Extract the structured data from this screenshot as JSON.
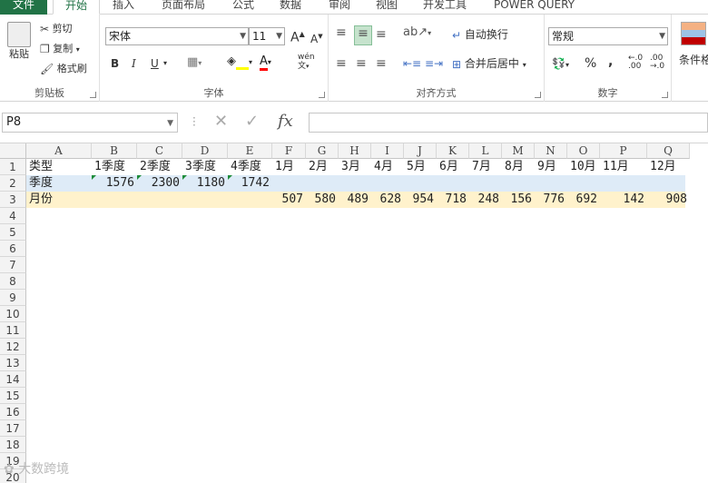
{
  "tabs": [
    "文件",
    "开始",
    "插入",
    "页面布局",
    "公式",
    "数据",
    "审阅",
    "视图",
    "开发工具",
    "POWER QUERY"
  ],
  "clipboard": {
    "paste": "粘贴",
    "cut": "剪切",
    "copy": "复制",
    "format_painter": "格式刷",
    "label": "剪贴板"
  },
  "font": {
    "name": "宋体",
    "size": "11",
    "label": "字体",
    "bold": "B",
    "italic": "I",
    "underline": "U",
    "grow": "A",
    "shrink": "A",
    "phonetic": "wén"
  },
  "alignment": {
    "wrap": "自动换行",
    "merge": "合并后居中",
    "label": "对齐方式"
  },
  "number": {
    "format": "常规",
    "label": "数字",
    "percent": "%",
    "comma": ",",
    "inc": ".00",
    "dec": ".0"
  },
  "styles": {
    "conditional": "条件格式"
  },
  "formula_bar": {
    "name_box": "P8",
    "fx": "fx",
    "content": ""
  },
  "columns": [
    "A",
    "B",
    "C",
    "D",
    "E",
    "F",
    "G",
    "H",
    "I",
    "J",
    "K",
    "L",
    "M",
    "N",
    "O",
    "P",
    "Q"
  ],
  "rows": [
    "1",
    "2",
    "3",
    "4",
    "5",
    "6",
    "7",
    "8",
    "9",
    "10",
    "11",
    "12",
    "13",
    "14",
    "15",
    "16",
    "17",
    "18",
    "19",
    "20"
  ],
  "grid": {
    "r1": [
      "类型",
      "1季度",
      "2季度",
      "3季度",
      "4季度",
      "1月",
      "2月",
      "3月",
      "4月",
      "5月",
      "6月",
      "7月",
      "8月",
      "9月",
      "10月",
      "11月",
      "12月"
    ],
    "r2": [
      "季度",
      "1576",
      "2300",
      "1180",
      "1742"
    ],
    "r3": [
      "月份",
      "507",
      "580",
      "489",
      "628",
      "954",
      "718",
      "248",
      "156",
      "776",
      "692",
      "142",
      "908"
    ]
  },
  "colors": {
    "accent": "#217346",
    "row2_fill": "#deebf7",
    "row3_fill": "#fff2cc",
    "error_triangle": "#1e8c3a"
  },
  "watermark": "大数跨境"
}
